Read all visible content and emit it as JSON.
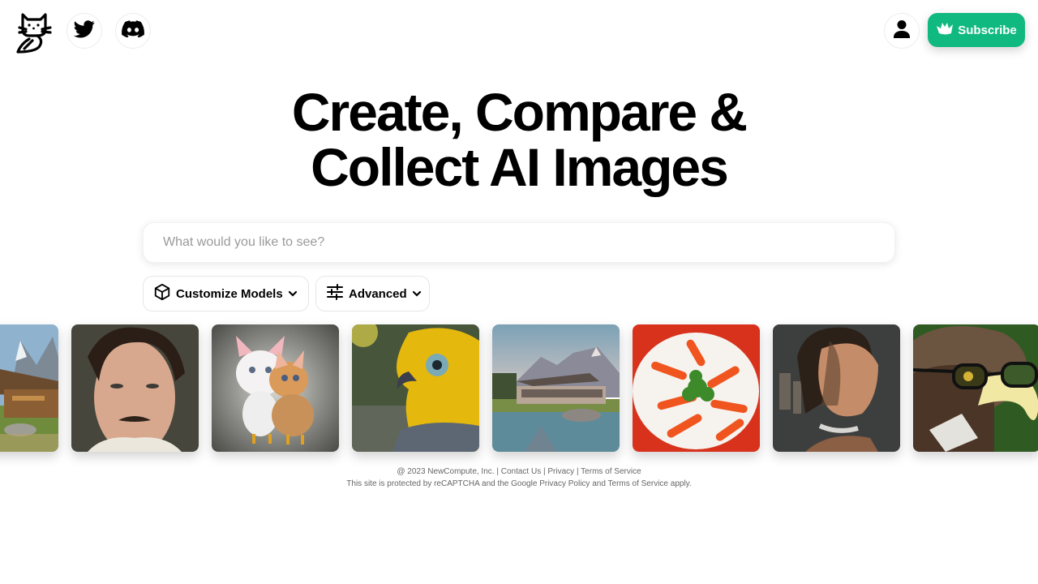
{
  "header": {
    "logo_name": "cat-logo",
    "social": [
      {
        "name": "twitter",
        "icon": "twitter-icon"
      },
      {
        "name": "discord",
        "icon": "discord-icon"
      }
    ],
    "account_icon": "user-icon",
    "subscribe_label": "Subscribe",
    "subscribe_icon": "crown-icon",
    "accent_color": "#10b97f"
  },
  "hero": {
    "line1": "Create, Compare &",
    "line2": "Collect AI Images"
  },
  "search": {
    "value": "",
    "placeholder": "What would you like to see?"
  },
  "options": {
    "models_label": "Customize Models",
    "models_icon": "cube-icon",
    "advanced_label": "Advanced",
    "advanced_icon": "sliders-icon"
  },
  "gallery": [
    {
      "subject": "mountain cabin landscape"
    },
    {
      "subject": "portrait of man with mustache"
    },
    {
      "subject": "kitten and chick"
    },
    {
      "subject": "yellow bird closeup"
    },
    {
      "subject": "modern house by mountain lake"
    },
    {
      "subject": "plate of carrots"
    },
    {
      "subject": "portrait of woman in light"
    },
    {
      "subject": "eagle wearing glasses"
    }
  ],
  "footer": {
    "copyright": "@ 2023 NewCompute, Inc.",
    "sep": "|",
    "contact": "Contact Us",
    "privacy": "Privacy",
    "terms": "Terms of Service",
    "recaptcha_prefix": "This site is protected by reCAPTCHA and the Google",
    "privacy_policy": "Privacy Policy",
    "and": "and",
    "terms_of_service": "Terms of Service",
    "apply": "apply."
  }
}
